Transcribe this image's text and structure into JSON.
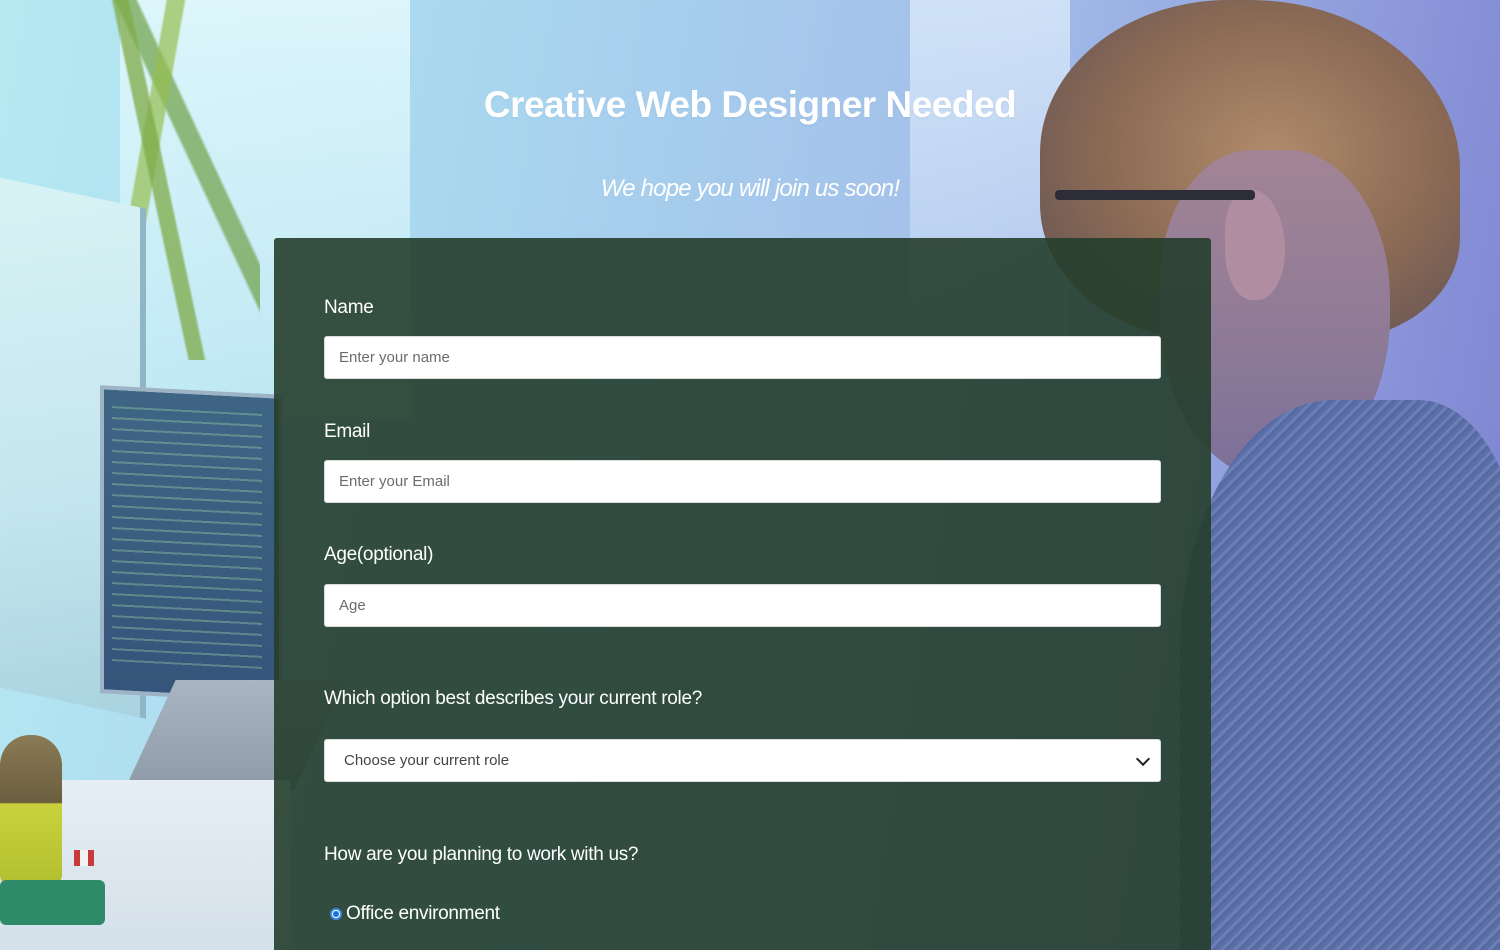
{
  "header": {
    "title": "Creative Web Designer Needed",
    "subtitle": "We hope you will join us soon!"
  },
  "form": {
    "name": {
      "label": "Name",
      "placeholder": "Enter your name",
      "value": ""
    },
    "email": {
      "label": "Email",
      "placeholder": "Enter your Email",
      "value": ""
    },
    "age": {
      "label": "Age(optional)",
      "placeholder": "Age",
      "value": ""
    },
    "role": {
      "label": "Which option best describes your current role?",
      "selected": "Choose your current role"
    },
    "work": {
      "label": "How are you planning to work with us?",
      "options": [
        {
          "label": "Office environment",
          "checked": true
        }
      ]
    }
  },
  "colors": {
    "panel": "#253e2c",
    "radio_accent": "#1f6fd8"
  },
  "icons": {
    "select_arrow": "chevron-down-icon",
    "radio": "radio-selected-icon"
  }
}
